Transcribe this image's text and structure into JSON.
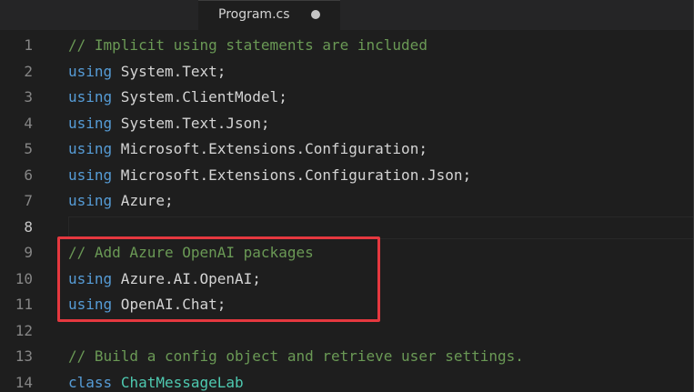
{
  "tab": {
    "title": "Program.cs",
    "unsaved": true
  },
  "editor": {
    "active_line": 8,
    "lines": [
      {
        "num": "1",
        "tokens": [
          {
            "t": "// Implicit using statements are included",
            "c": "cm"
          }
        ]
      },
      {
        "num": "2",
        "tokens": [
          {
            "t": "using",
            "c": "kw"
          },
          {
            "t": " System.Text;",
            "c": ""
          }
        ]
      },
      {
        "num": "3",
        "tokens": [
          {
            "t": "using",
            "c": "kw"
          },
          {
            "t": " System.ClientModel;",
            "c": ""
          }
        ]
      },
      {
        "num": "4",
        "tokens": [
          {
            "t": "using",
            "c": "kw"
          },
          {
            "t": " System.Text.Json;",
            "c": ""
          }
        ]
      },
      {
        "num": "5",
        "tokens": [
          {
            "t": "using",
            "c": "kw"
          },
          {
            "t": " Microsoft.Extensions.Configuration;",
            "c": ""
          }
        ]
      },
      {
        "num": "6",
        "tokens": [
          {
            "t": "using",
            "c": "kw"
          },
          {
            "t": " Microsoft.Extensions.Configuration.Json;",
            "c": ""
          }
        ]
      },
      {
        "num": "7",
        "tokens": [
          {
            "t": "using",
            "c": "kw"
          },
          {
            "t": " Azure;",
            "c": ""
          }
        ]
      },
      {
        "num": "8",
        "tokens": []
      },
      {
        "num": "9",
        "tokens": [
          {
            "t": "// Add Azure OpenAI packages",
            "c": "cm"
          }
        ]
      },
      {
        "num": "10",
        "tokens": [
          {
            "t": "using",
            "c": "kw"
          },
          {
            "t": " Azure.AI.OpenAI;",
            "c": ""
          }
        ]
      },
      {
        "num": "11",
        "tokens": [
          {
            "t": "using",
            "c": "kw"
          },
          {
            "t": " OpenAI.Chat;",
            "c": ""
          }
        ]
      },
      {
        "num": "12",
        "tokens": []
      },
      {
        "num": "13",
        "tokens": [
          {
            "t": "// Build a config object and retrieve user settings.",
            "c": "cm"
          }
        ]
      },
      {
        "num": "14",
        "tokens": [
          {
            "t": "class",
            "c": "kw"
          },
          {
            "t": " ",
            "c": ""
          },
          {
            "t": "ChatMessageLab",
            "c": "cls"
          }
        ]
      }
    ]
  },
  "colors": {
    "background": "#1e1e1e",
    "keyword": "#569cd6",
    "comment": "#6a9955",
    "class_name": "#4ec9b0",
    "highlight_box": "#e5383f"
  }
}
